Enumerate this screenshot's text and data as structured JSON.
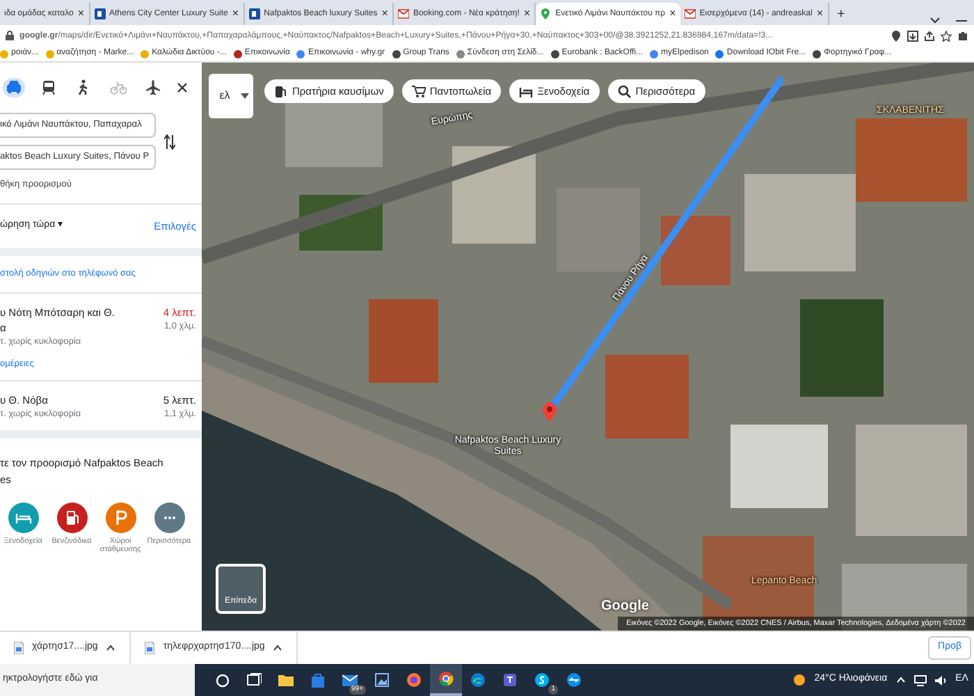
{
  "browser": {
    "tabs": [
      {
        "title": "ιδα ομάδας καταλο",
        "close": "×",
        "selected": false
      },
      {
        "title": "Athens City Center Luxury Suite",
        "kind": "square",
        "close": "×",
        "selected": false
      },
      {
        "title": "Nafpaktos Beach luxury Suites",
        "kind": "square",
        "close": "×",
        "selected": false
      },
      {
        "title": "Booking.com - Νέα κράτηση!",
        "kind": "mail",
        "close": "×",
        "selected": false
      },
      {
        "title": "Ενετικό Λιμάνι Ναυπάκτου πρ",
        "kind": "pin",
        "close": "×",
        "selected": true
      },
      {
        "title": "Εισερχόμενα (14) - andreaskal",
        "kind": "mail",
        "close": "×",
        "selected": false
      }
    ],
    "new_tab": "+",
    "address": "**google.gr**/maps/dir/Ενετικό+Λιμάνι+Ναυπάκτου,+Παπαχαραλάμπους,+Ναύπακτος/Nafpaktos+Beach+Luxury+Suites,+Πάνου+Ρήγα+30,+Ναύπακτος+303+00/@38.3921252,21.836984,167m/data=!3...",
    "bookmarks": [
      "ροιάν...",
      "αναζήτηση - Marke...",
      "Καλώδια Δικτύου -...",
      "Επικοινωνία",
      "Επικοινωνία - why.gr",
      "Group Trans",
      "Σύνδεση στη Σελίδ...",
      "Eurobank : BackOffi...",
      "myElpedison",
      "Download IObit Fre...",
      "Φορτηγικό Γραφ..."
    ]
  },
  "directions_panel": {
    "travel_modes": [
      {
        "kind": "car",
        "selected": true,
        "disabled": false
      },
      {
        "kind": "transit",
        "selected": false,
        "disabled": false
      },
      {
        "kind": "walk",
        "selected": false,
        "disabled": false
      },
      {
        "kind": "bike",
        "selected": false,
        "disabled": true
      },
      {
        "kind": "flight",
        "selected": false,
        "disabled": false
      }
    ],
    "origin": "ικό Λιμάνι Ναυπάκτου, Παπαχαραλ",
    "destination": "aktos Beach Luxury Suites, Πάνου Ρ",
    "add_destination": "θήκη προορισμού",
    "depart": "ώρηση τώρα ▾",
    "options": "Επιλογές",
    "send_to_phone": "στολή οδηγιών στο τηλέφωνό σας",
    "routes": [
      {
        "via": "υ Νότη Μπότσαρη και Θ.",
        "via_line_2": "α",
        "time": "4 λεπτ.",
        "color": "#c5221f",
        "distance": "1,0 χλμ.",
        "traffic": "τ. χωρίς κυκλοφορία",
        "details": "ομέρειες"
      },
      {
        "via": "υ Θ. Νόβα",
        "time": "5 λεπτ.",
        "color": "#202124",
        "distance": "1,1 χλμ.",
        "traffic": "τ. χωρίς κυκλοφορία"
      }
    ],
    "nearby": {
      "title": "τε τον προορισμό Nafpaktos Beach es",
      "categories": [
        {
          "kind": "hotel",
          "label": "Ξενοδοχεία",
          "color": "#129eaf"
        },
        {
          "kind": "fuel",
          "label": "Βενζινάδικα",
          "color": "#c5221f"
        },
        {
          "kind": "parking",
          "label": "Χώροι στάθμευσης",
          "color": "#e8710a"
        },
        {
          "kind": "more",
          "label": "Περισσότερα",
          "color": "#5f7987"
        }
      ]
    }
  },
  "map": {
    "language": "ελ",
    "chips": [
      {
        "kind": "fuel",
        "label": "Πρατήρια καυσίμων"
      },
      {
        "kind": "cart",
        "label": "Παντοπωλεία"
      },
      {
        "kind": "hotel",
        "label": "Ξενοδοχεία"
      },
      {
        "kind": "search",
        "label": "Περισσότερα"
      }
    ],
    "labels": [
      {
        "text": "Ευρώπης",
        "kind": "street"
      },
      {
        "text": "Πάνου Ρήγα",
        "kind": "street"
      },
      {
        "text": "ΣΚΛΑΒΕΝΙΤΗΣ",
        "kind": "poi"
      },
      {
        "text": "Lepanto Beach",
        "kind": "poi"
      }
    ],
    "pin_label": "Nafpaktos Beach Luxury Suites",
    "layers": "Επίπεδα",
    "logo": "Google",
    "attribution": "Εικόνες ©2022 Google, Εικόνες ©2022 CNES / Airbus, Maxar Technologies, Δεδομένα χάρτη ©2022"
  },
  "downloads": {
    "files": [
      "χάρτησ17....jpg",
      "τηλεφρχαρτησ170....jpg"
    ],
    "show_all": "Προβ"
  },
  "taskbar": {
    "search": "ηκτρολογήστε εδώ για",
    "apps": [
      {
        "kind": "taskview",
        "selected": false
      },
      {
        "kind": "folder",
        "selected": false
      },
      {
        "kind": "bag",
        "selected": false
      },
      {
        "kind": "mail",
        "selected": false,
        "badge": "99+"
      },
      {
        "kind": "photos",
        "selected": false
      },
      {
        "kind": "firefox",
        "selected": false
      },
      {
        "kind": "chrome",
        "selected": true
      },
      {
        "kind": "edge",
        "selected": false
      },
      {
        "kind": "teams",
        "selected": false
      },
      {
        "kind": "skype",
        "selected": false,
        "badge": "1"
      },
      {
        "kind": "teamviewer",
        "selected": false
      }
    ],
    "weather": "24°C Ηλιοφάνεια",
    "language": "ΕΛ"
  }
}
